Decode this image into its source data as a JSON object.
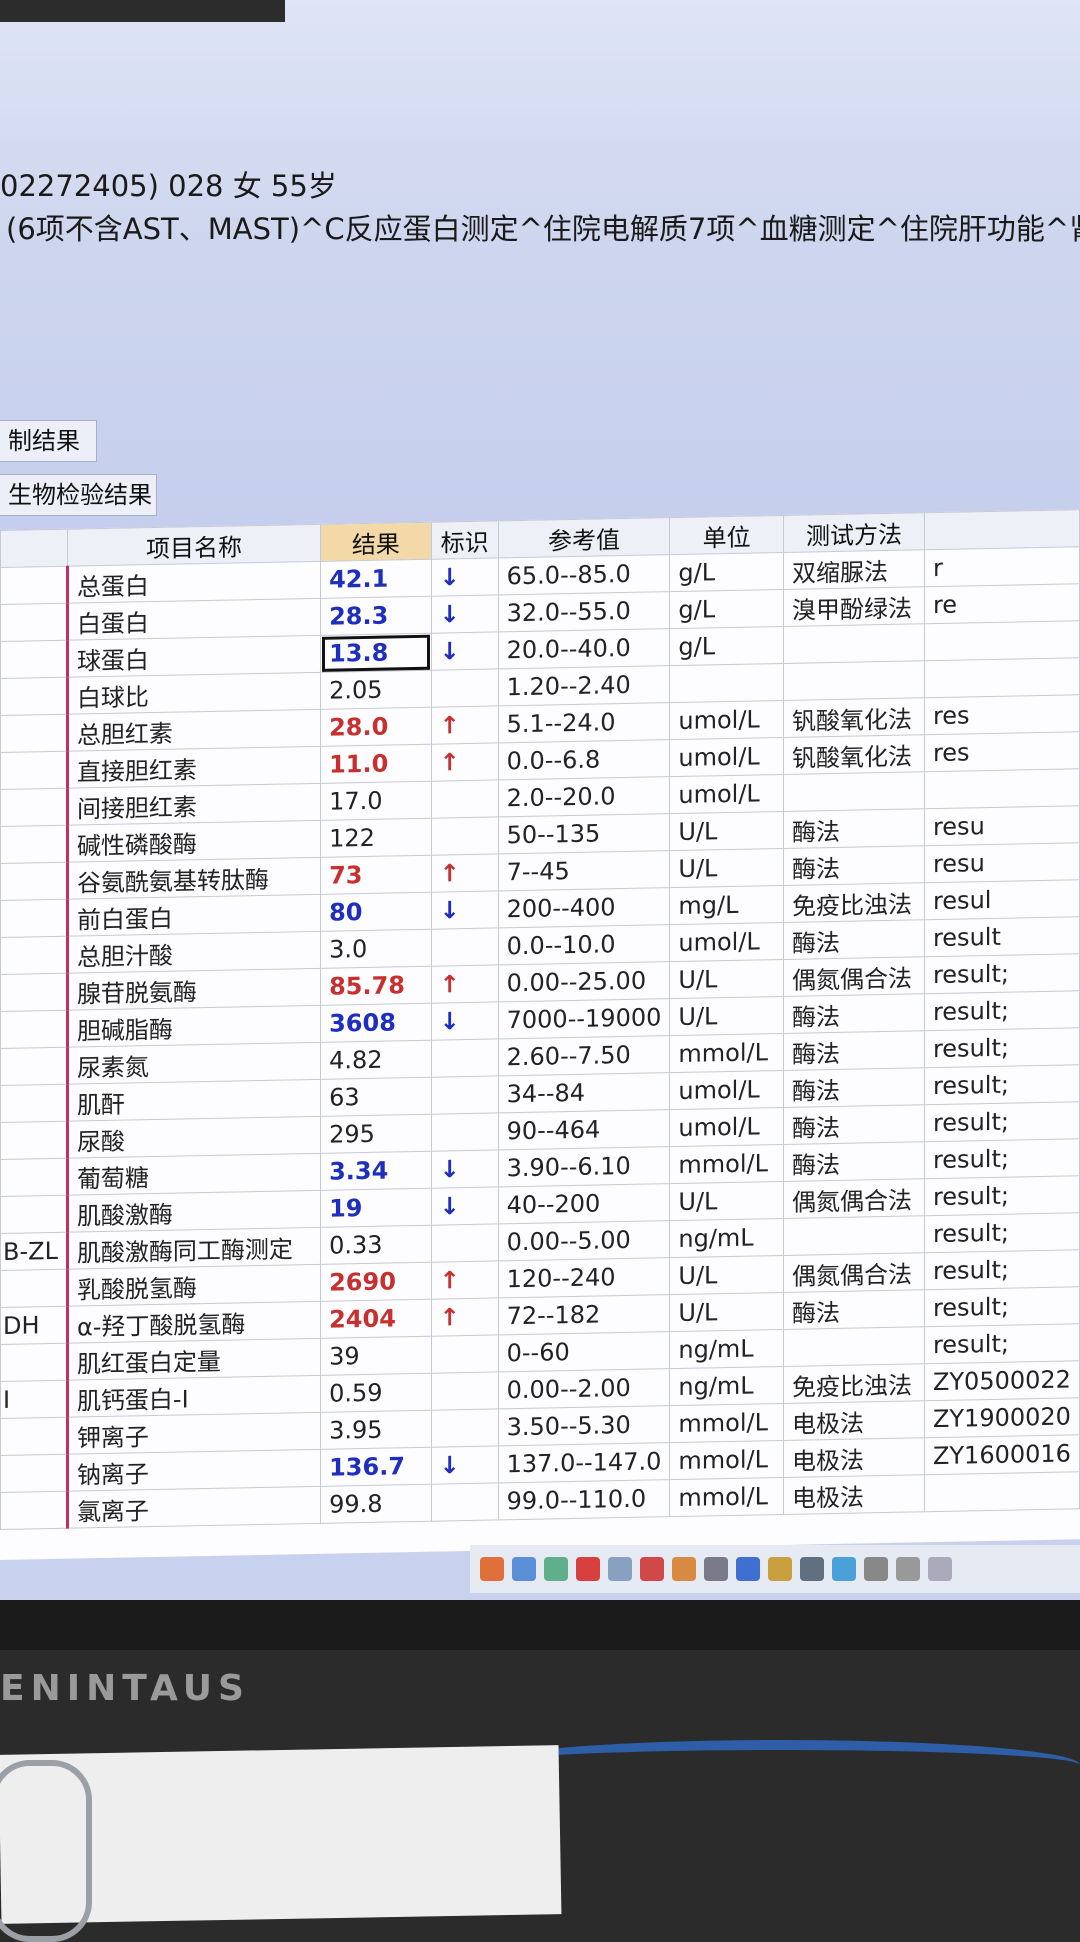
{
  "patient_line": "02272405) 028 女 55岁",
  "tests_line": "(6项不含AST、MAST)^C反应蛋白测定^住院电解质7项^血糖测定^住院肝功能^肾功能",
  "tabs": [
    "制结果",
    "生物检验结果"
  ],
  "columns": [
    "",
    "项目名称",
    "结果",
    "标识",
    "参考值",
    "单位",
    "测试方法",
    ""
  ],
  "rows": [
    {
      "code": "",
      "name": "总蛋白",
      "value": "42.1",
      "flag": "↓",
      "ref": "65.0--85.0",
      "unit": "g/L",
      "method": "双缩脲法",
      "extra": "r"
    },
    {
      "code": "",
      "name": "白蛋白",
      "value": "28.3",
      "flag": "↓",
      "ref": "32.0--55.0",
      "unit": "g/L",
      "method": "溴甲酚绿法",
      "extra": "re"
    },
    {
      "code": "",
      "name": "球蛋白",
      "value": "13.8",
      "flag": "↓",
      "ref": "20.0--40.0",
      "unit": "g/L",
      "method": "",
      "extra": ""
    },
    {
      "code": "",
      "name": "白球比",
      "value": "2.05",
      "flag": "",
      "ref": "1.20--2.40",
      "unit": "",
      "method": "",
      "extra": ""
    },
    {
      "code": "",
      "name": "总胆红素",
      "value": "28.0",
      "flag": "↑",
      "ref": "5.1--24.0",
      "unit": "umol/L",
      "method": "钒酸氧化法",
      "extra": "res"
    },
    {
      "code": "",
      "name": "直接胆红素",
      "value": "11.0",
      "flag": "↑",
      "ref": "0.0--6.8",
      "unit": "umol/L",
      "method": "钒酸氧化法",
      "extra": "res"
    },
    {
      "code": "",
      "name": "间接胆红素",
      "value": "17.0",
      "flag": "",
      "ref": "2.0--20.0",
      "unit": "umol/L",
      "method": "",
      "extra": ""
    },
    {
      "code": "",
      "name": "碱性磷酸酶",
      "value": "122",
      "flag": "",
      "ref": "50--135",
      "unit": "U/L",
      "method": "酶法",
      "extra": "resu"
    },
    {
      "code": "",
      "name": "谷氨酰氨基转肽酶",
      "value": "73",
      "flag": "↑",
      "ref": "7--45",
      "unit": "U/L",
      "method": "酶法",
      "extra": "resu"
    },
    {
      "code": "",
      "name": "前白蛋白",
      "value": "80",
      "flag": "↓",
      "ref": "200--400",
      "unit": "mg/L",
      "method": "免疫比浊法",
      "extra": "resul"
    },
    {
      "code": "",
      "name": "总胆汁酸",
      "value": "3.0",
      "flag": "",
      "ref": "0.0--10.0",
      "unit": "umol/L",
      "method": "酶法",
      "extra": "result"
    },
    {
      "code": "",
      "name": "腺苷脱氨酶",
      "value": "85.78",
      "flag": "↑",
      "ref": "0.00--25.00",
      "unit": "U/L",
      "method": "偶氮偶合法",
      "extra": "result;"
    },
    {
      "code": "",
      "name": "胆碱脂酶",
      "value": "3608",
      "flag": "↓",
      "ref": "7000--19000",
      "unit": "U/L",
      "method": "酶法",
      "extra": "result;"
    },
    {
      "code": "",
      "name": "尿素氮",
      "value": "4.82",
      "flag": "",
      "ref": "2.60--7.50",
      "unit": "mmol/L",
      "method": "酶法",
      "extra": "result;"
    },
    {
      "code": "",
      "name": "肌酐",
      "value": "63",
      "flag": "",
      "ref": "34--84",
      "unit": "umol/L",
      "method": "酶法",
      "extra": "result;"
    },
    {
      "code": "",
      "name": "尿酸",
      "value": "295",
      "flag": "",
      "ref": "90--464",
      "unit": "umol/L",
      "method": "酶法",
      "extra": "result;"
    },
    {
      "code": "",
      "name": "葡萄糖",
      "value": "3.34",
      "flag": "↓",
      "ref": "3.90--6.10",
      "unit": "mmol/L",
      "method": "酶法",
      "extra": "result;"
    },
    {
      "code": "",
      "name": "肌酸激酶",
      "value": "19",
      "flag": "↓",
      "ref": "40--200",
      "unit": "U/L",
      "method": "偶氮偶合法",
      "extra": "result;"
    },
    {
      "code": "B-ZL",
      "name": "肌酸激酶同工酶测定",
      "value": "0.33",
      "flag": "",
      "ref": "0.00--5.00",
      "unit": "ng/mL",
      "method": "",
      "extra": "result;"
    },
    {
      "code": "",
      "name": "乳酸脱氢酶",
      "value": "2690",
      "flag": "↑",
      "ref": "120--240",
      "unit": "U/L",
      "method": "偶氮偶合法",
      "extra": "result;"
    },
    {
      "code": "DH",
      "name": "α-羟丁酸脱氢酶",
      "value": "2404",
      "flag": "↑",
      "ref": "72--182",
      "unit": "U/L",
      "method": "酶法",
      "extra": "result;"
    },
    {
      "code": "",
      "name": "肌红蛋白定量",
      "value": "39",
      "flag": "",
      "ref": "0--60",
      "unit": "ng/mL",
      "method": "",
      "extra": "result;"
    },
    {
      "code": "I",
      "name": "肌钙蛋白-Ⅰ",
      "value": "0.59",
      "flag": "",
      "ref": "0.00--2.00",
      "unit": "ng/mL",
      "method": "免疫比浊法",
      "extra": "ZY0500022"
    },
    {
      "code": "",
      "name": "钾离子",
      "value": "3.95",
      "flag": "",
      "ref": "3.50--5.30",
      "unit": "mmol/L",
      "method": "电极法",
      "extra": "ZY1900020"
    },
    {
      "code": "",
      "name": "钠离子",
      "value": "136.7",
      "flag": "↓",
      "ref": "137.0--147.0",
      "unit": "mmol/L",
      "method": "电极法",
      "extra": "ZY1600016"
    },
    {
      "code": "",
      "name": "氯离子",
      "value": "99.8",
      "flag": "",
      "ref": "99.0--110.0",
      "unit": "mmol/L",
      "method": "电极法",
      "extra": ""
    }
  ],
  "colors": {
    "low": "#1e2fbf",
    "high": "#c83030",
    "result_header": "#f3d9a8"
  },
  "brand": "ENINTAUS"
}
